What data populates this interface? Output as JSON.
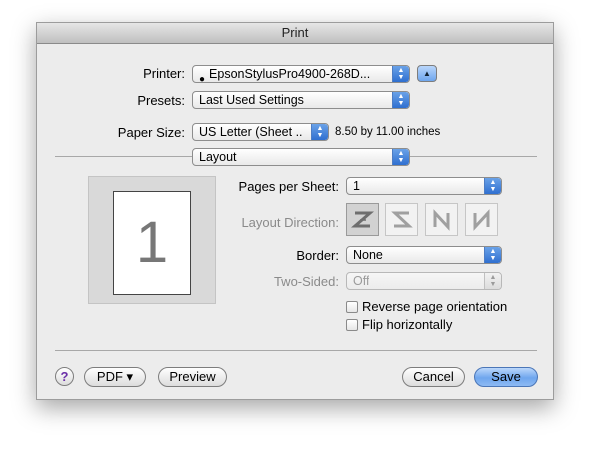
{
  "window": {
    "title": "Print"
  },
  "printer": {
    "label": "Printer:",
    "value": "EpsonStylusPro4900-268D..."
  },
  "presets": {
    "label": "Presets:",
    "value": "Last Used Settings"
  },
  "paper_size": {
    "label": "Paper Size:",
    "value": "US Letter (Sheet ...",
    "dimensions": "8.50 by 11.00 inches"
  },
  "section": {
    "value": "Layout"
  },
  "preview": {
    "page_number": "1"
  },
  "pages_per_sheet": {
    "label": "Pages per Sheet:",
    "value": "1"
  },
  "layout_direction": {
    "label": "Layout Direction:"
  },
  "border": {
    "label": "Border:",
    "value": "None"
  },
  "two_sided": {
    "label": "Two-Sided:",
    "value": "Off"
  },
  "options": {
    "reverse_orientation": {
      "label": "Reverse page orientation",
      "checked": false
    },
    "flip_horizontally": {
      "label": "Flip horizontally",
      "checked": false
    }
  },
  "footer": {
    "help": "?",
    "pdf": "PDF ▾",
    "preview": "Preview",
    "cancel": "Cancel",
    "save": "Save"
  },
  "icons": {
    "updown": "▲▼",
    "disclosure": "▲",
    "printer_status": "●"
  },
  "colors": {
    "accent": "#4a8ee8",
    "help_glyph": "#6b2fa8"
  }
}
